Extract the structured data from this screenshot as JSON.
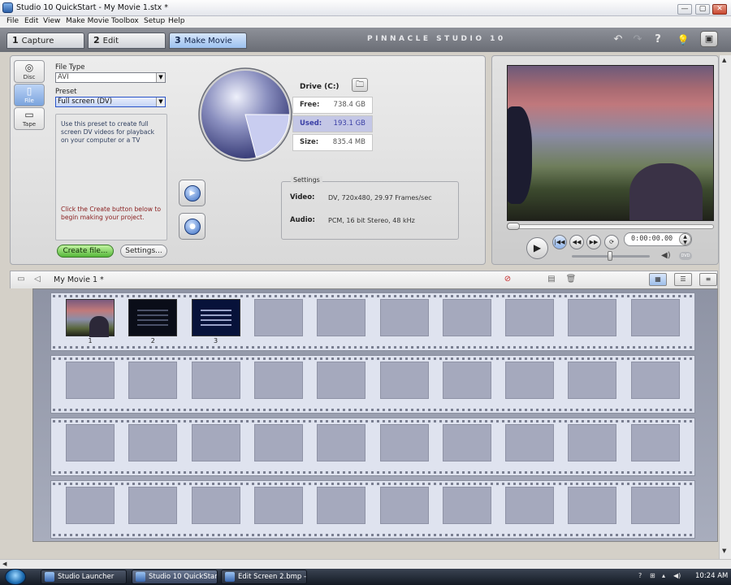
{
  "window": {
    "title": "Studio 10 QuickStart - My Movie 1.stx *",
    "min_glyph": "—",
    "max_glyph": "▢",
    "close_glyph": "✕"
  },
  "menu": [
    "File",
    "Edit",
    "View",
    "Make Movie",
    "Toolbox",
    "Setup",
    "Help"
  ],
  "tabs": [
    {
      "num": "1",
      "label": "Capture",
      "active": false
    },
    {
      "num": "2",
      "label": "Edit",
      "active": false
    },
    {
      "num": "3",
      "label": "Make Movie",
      "active": true
    }
  ],
  "brand": "PINNACLE STUDIO 10",
  "toolbar_icons": [
    "undo-icon",
    "redo-icon",
    "help-icon",
    "bulb-icon",
    "toolbox-icon"
  ],
  "output_types": [
    {
      "icon": "disc-icon",
      "label": "Disc",
      "active": false
    },
    {
      "icon": "file-icon",
      "label": "File",
      "active": true
    },
    {
      "icon": "tape-icon",
      "label": "Tape",
      "active": false
    }
  ],
  "file_type": {
    "label": "File Type",
    "value": "AVI"
  },
  "preset": {
    "label": "Preset",
    "value": "Full screen (DV)"
  },
  "description": "Use this preset to create full screen DV videos for playback on your computer or a TV",
  "hint": "Click the Create button below to begin making your project.",
  "buttons": {
    "create": "Create file...",
    "settings": "Settings..."
  },
  "disk": {
    "drive": "Drive (C:)",
    "free_label": "Free:",
    "free_value": "738.4 GB",
    "used_label": "Used:",
    "used_value": "193.1 GB",
    "size_label": "Size:",
    "size_value": "835.4 MB",
    "used_fraction": 0.21
  },
  "settings": {
    "legend": "Settings",
    "video_label": "Video:",
    "video_value": "DV, 720x480, 29.97 Frames/sec",
    "audio_label": "Audio:",
    "audio_value": "PCM, 16 bit Stereo, 48 kHz"
  },
  "player": {
    "timecode": "0:00:00.00"
  },
  "album": {
    "movie_title": "My Movie 1 *"
  },
  "storyboard": {
    "rows": 4,
    "cells_per_row": 10,
    "clips": [
      {
        "number": "1",
        "kind": "video"
      },
      {
        "number": "2",
        "kind": "title-dark"
      },
      {
        "number": "3",
        "kind": "title-blue"
      }
    ]
  },
  "taskbar": {
    "items": [
      "Studio Launcher",
      "Studio 10 QuickStart ...",
      "Edit Screen 2.bmp - ..."
    ],
    "clock": "10:24 AM"
  },
  "colors": {
    "accent": "#7aa3dd",
    "create_green": "#56b83a",
    "disk_used": "#c4c7e6"
  }
}
